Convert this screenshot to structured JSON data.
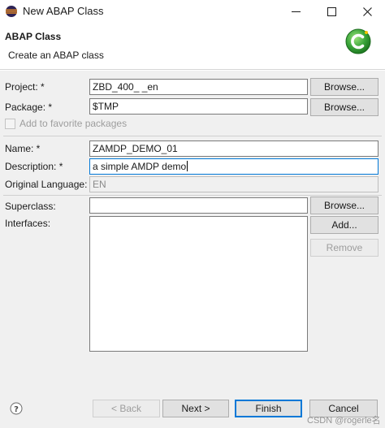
{
  "window": {
    "title": "New ABAP Class",
    "minimize_icon": "minimize-icon",
    "maximize_icon": "maximize-icon",
    "close_icon": "close-icon"
  },
  "banner": {
    "title": "ABAP Class",
    "message": "Create an ABAP class",
    "logo_icon": "abap-class-logo-icon",
    "logo_color": "#3aa53a"
  },
  "form": {
    "project": {
      "label": "Project: *",
      "value": "ZBD_400_      _en",
      "browse": "Browse..."
    },
    "package": {
      "label": "Package: *",
      "value": "$TMP",
      "browse": "Browse..."
    },
    "favorites": {
      "label": "Add to favorite packages",
      "checked": false
    },
    "name": {
      "label": "Name: *",
      "value": "ZAMDP_DEMO_01"
    },
    "description": {
      "label": "Description: *",
      "value": "a simple AMDP demo"
    },
    "original_language": {
      "label": "Original Language:",
      "value": "EN"
    },
    "superclass": {
      "label": "Superclass:",
      "value": "",
      "browse": "Browse..."
    },
    "interfaces": {
      "label": "Interfaces:",
      "add": "Add...",
      "remove": "Remove"
    }
  },
  "footer": {
    "help_icon": "help-icon",
    "back": "< Back",
    "next": "Next >",
    "finish": "Finish",
    "cancel": "Cancel"
  },
  "watermark": "CSDN @rogerle名"
}
